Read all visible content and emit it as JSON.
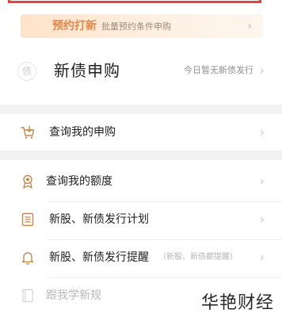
{
  "promo": {
    "title": "预约打新",
    "subtitle": "批量预约条件申购"
  },
  "bond": {
    "icon_char": "债",
    "title": "新债申购",
    "status": "今日暂无新债发行"
  },
  "menu": {
    "my_subscription": "查询我的申购",
    "my_quota": "查询我的额度",
    "issue_plan": "新股、新债发行计划",
    "issue_reminder": "新股、新债发行提醒",
    "reminder_note": "（新股、新债都提醒）",
    "learn_rules": "跟我学新规"
  },
  "watermark": "华艳财经",
  "colors": {
    "accent": "#e0874a",
    "icon": "#c2894f"
  }
}
